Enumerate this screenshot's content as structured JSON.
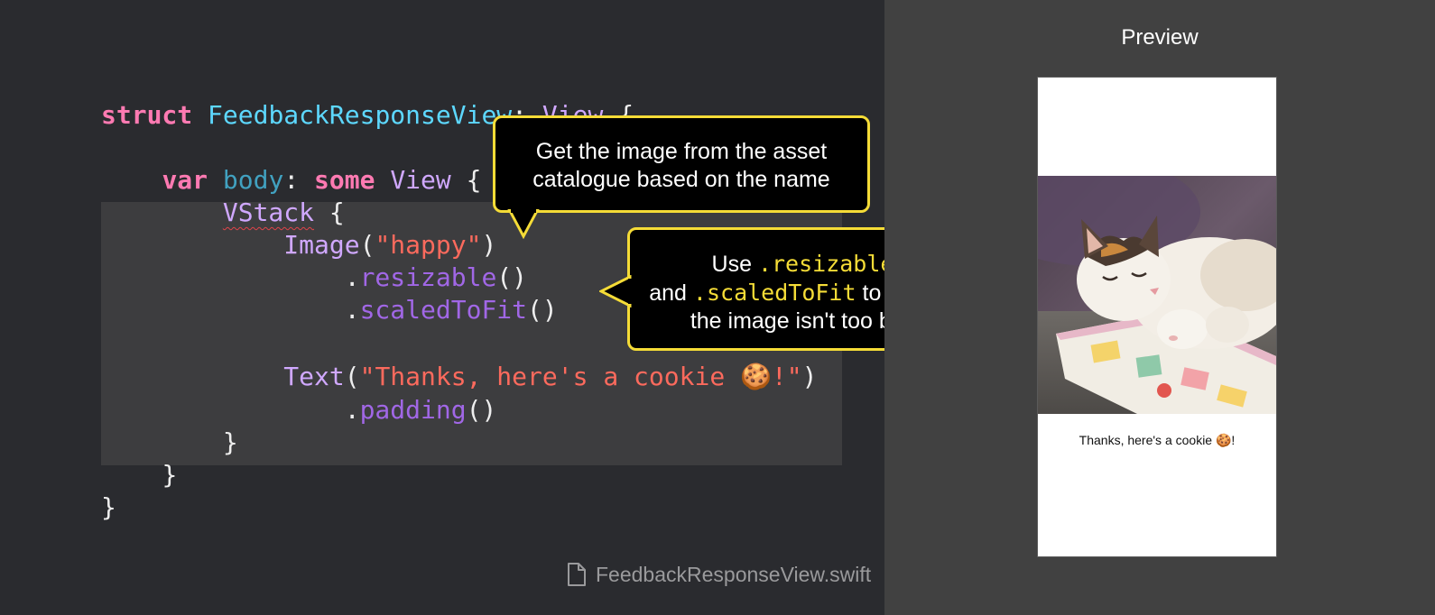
{
  "editor": {
    "code": {
      "line1": {
        "kw": "struct",
        "name": "FeedbackResponseView",
        "colon": ":",
        "type": "View",
        "brace": "{"
      },
      "line3": {
        "kw": "var",
        "name": "body",
        "colon": ":",
        "kw2": "some",
        "type": "View",
        "brace": "{"
      },
      "line4": {
        "type": "VStack",
        "brace": "{"
      },
      "line5": {
        "fn": "Image",
        "open": "(",
        "str": "\"happy\"",
        "close": ")"
      },
      "line6": {
        "dot": ".",
        "method": "resizable",
        "parens": "()"
      },
      "line7": {
        "dot": ".",
        "method": "scaledToFit",
        "parens": "()"
      },
      "line9": {
        "fn": "Text",
        "open": "(",
        "str": "\"Thanks, here's a cookie 🍪!\"",
        "close": ")"
      },
      "line10": {
        "dot": ".",
        "method": "padding",
        "parens": "()"
      },
      "line11": {
        "brace": "}"
      },
      "line12": {
        "brace": "}"
      },
      "line13": {
        "brace": "}"
      }
    },
    "callouts": {
      "asset": {
        "line1": "Get the image from the asset",
        "line2": "catalogue based on the name"
      },
      "resize": {
        "use": "Use",
        "resizable": ".resizable",
        "and": "and",
        "scaledToFit": ".scaledToFit",
        "to_ensure": "to ensure",
        "line3": "the image isn't too big."
      }
    },
    "file_name": "FeedbackResponseView.swift",
    "file_icon": "document-icon"
  },
  "preview": {
    "title": "Preview",
    "caption": "Thanks, here's a cookie 🍪!",
    "image_subject": "sleeping-cat-photo"
  },
  "colors": {
    "editor_bg": "#2a2b2f",
    "preview_bg": "#414141",
    "keyword": "#ff7ab2",
    "type": "#5dd8ff",
    "string": "#fc6a5d",
    "method": "#a167e6",
    "callout_border": "#f5dc37"
  }
}
